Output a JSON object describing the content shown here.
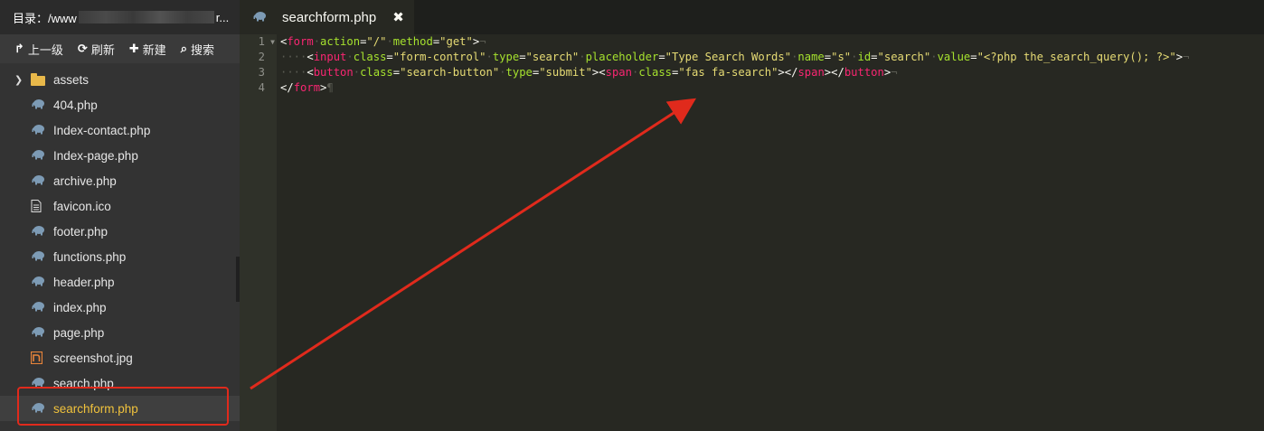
{
  "sidebar": {
    "dir_label": "目录：/www",
    "dir_tail": "r...",
    "toolbar": [
      {
        "icon": "↱",
        "label": "上一级",
        "name": "up-level-button",
        "icon_name": "share-arrow-icon"
      },
      {
        "icon": "⟳",
        "label": "刷新",
        "name": "refresh-button",
        "icon_name": "refresh-icon"
      },
      {
        "icon": "✚",
        "label": "新建",
        "name": "new-button",
        "icon_name": "plus-icon"
      },
      {
        "icon": "⌕",
        "label": "搜索",
        "name": "search-button",
        "icon_name": "search-icon"
      }
    ],
    "items": [
      {
        "label": "assets",
        "type": "folder"
      },
      {
        "label": "404.php",
        "type": "php"
      },
      {
        "label": "Index-contact.php",
        "type": "php"
      },
      {
        "label": "Index-page.php",
        "type": "php"
      },
      {
        "label": "archive.php",
        "type": "php"
      },
      {
        "label": "favicon.ico",
        "type": "file"
      },
      {
        "label": "footer.php",
        "type": "php"
      },
      {
        "label": "functions.php",
        "type": "php"
      },
      {
        "label": "header.php",
        "type": "php"
      },
      {
        "label": "index.php",
        "type": "php"
      },
      {
        "label": "page.php",
        "type": "php"
      },
      {
        "label": "screenshot.jpg",
        "type": "image"
      },
      {
        "label": "search.php",
        "type": "php"
      },
      {
        "label": "searchform.php",
        "type": "php",
        "selected": true
      }
    ]
  },
  "editor": {
    "tab": {
      "label": "searchform.php",
      "close": "✖"
    },
    "line_numbers": [
      "1",
      "2",
      "3",
      "4"
    ],
    "code_lines": [
      [
        "<form action=\"/\" method=\"get\">"
      ],
      [
        "    <input class=\"form-control\" type=\"search\" placeholder=\"Type Search Words\" name=\"s\" id=\"search\" value=\"<?php the_search_query(); ?>\">"
      ],
      [
        "    <button class=\"search-button\" type=\"submit\"><span class=\"fas fa-search\"></span></button>"
      ],
      [
        "</form>"
      ]
    ]
  },
  "colors": {
    "sidebar_bg": "#333333",
    "editor_bg": "#272822",
    "selected_text": "#f0c23c",
    "annotation_red": "#e02a1c",
    "tag": "#f92672",
    "attr": "#a6e22e",
    "string": "#e6db74"
  }
}
